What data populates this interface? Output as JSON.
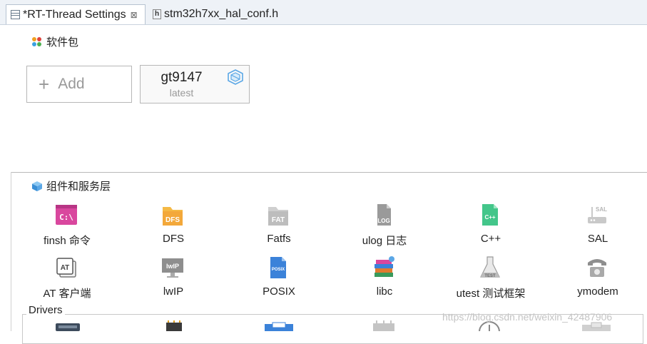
{
  "tabs": [
    {
      "label": "*RT-Thread Settings",
      "icon": "settings-file-icon",
      "close": "⊠"
    },
    {
      "label": "stm32h7xx_hal_conf.h",
      "icon": "header-file-icon"
    }
  ],
  "packages": {
    "title": "软件包",
    "add_label": "Add",
    "items": [
      {
        "name": "gt9147",
        "version": "latest"
      }
    ]
  },
  "components": {
    "title": "组件和服务层",
    "items": [
      {
        "label": "finsh 命令",
        "icon": "finsh-terminal-icon",
        "icon_text": "C:\\"
      },
      {
        "label": "DFS",
        "icon": "dfs-folder-icon",
        "icon_text": "DFS"
      },
      {
        "label": "Fatfs",
        "icon": "fatfs-icon",
        "icon_text": "FAT"
      },
      {
        "label": "ulog 日志",
        "icon": "ulog-file-icon",
        "icon_text": "LOG"
      },
      {
        "label": "C++",
        "icon": "cpp-file-icon",
        "icon_text": "C++"
      },
      {
        "label": "SAL",
        "icon": "sal-router-icon",
        "icon_text": "SAL"
      },
      {
        "label": "AT 客户端",
        "icon": "at-client-icon",
        "icon_text": "AT"
      },
      {
        "label": "lwIP",
        "icon": "lwip-monitor-icon",
        "icon_text": "lwIP"
      },
      {
        "label": "POSIX",
        "icon": "posix-file-icon",
        "icon_text": "POSIX"
      },
      {
        "label": "libc",
        "icon": "libc-books-icon",
        "icon_text": ""
      },
      {
        "label": "utest 测试框架",
        "icon": "utest-flask-icon",
        "icon_text": "TEST"
      },
      {
        "label": "ymodem",
        "icon": "ymodem-phone-icon",
        "icon_text": ""
      }
    ]
  },
  "drivers": {
    "title": "Drivers",
    "icons": [
      "serial-port-icon",
      "chip-icon",
      "can-bus-icon",
      "sfud-flash-icon",
      "clock-icon",
      "i2c-bus-icon"
    ]
  },
  "watermark": "https://blog.csdn.net/weixin_42487906",
  "colors": {
    "accent": "#5aa7e6",
    "tab_bg": "#eef2f7",
    "border": "#b7b7b7"
  }
}
